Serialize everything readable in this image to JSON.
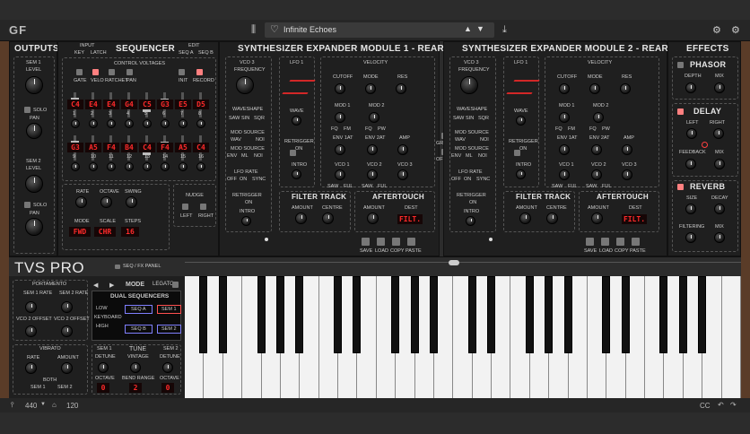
{
  "app": {
    "logo": "GF",
    "preset_name": "Infinite Echoes",
    "product": "TVS PRO",
    "seq_fx_panel": "SEQ / FX PANEL"
  },
  "outputs": {
    "title": "OUTPUTS",
    "sem1": "SEM 1",
    "sem2": "SEM 2",
    "level": "LEVEL",
    "solo": "SOLO",
    "pan": "PAN"
  },
  "sequencer": {
    "title": "SEQUENCER",
    "input": "INPUT",
    "edit": "EDIT",
    "key": "KEY",
    "latch": "LATCH",
    "seq_a": "SEQ A",
    "seq_b": "SEQ B",
    "control_voltages": "CONTROL VOLTAGES",
    "gate": "GATE",
    "velo": "VELO",
    "ratchet": "RATCHET",
    "pan": "PAN",
    "init": "INIT",
    "record": "RECORD",
    "steps_top": [
      "C4",
      "E4",
      "E4",
      "G4",
      "C5",
      "G3",
      "E5",
      "D5"
    ],
    "steps_bottom": [
      "G3",
      "A5",
      "F4",
      "B4",
      "C4",
      "F4",
      "A5",
      "C4"
    ],
    "numbers_top": [
      "1",
      "2",
      "3",
      "4",
      "5",
      "6",
      "7",
      "8"
    ],
    "numbers_bottom": [
      "9",
      "10",
      "11",
      "12",
      "13",
      "14",
      "15",
      "16"
    ],
    "rate": "RATE",
    "octave": "OCTAVE",
    "swing": "SWING",
    "mode": "MODE",
    "scale": "SCALE",
    "steps": "STEPS",
    "mode_val": "FWD",
    "scale_val": "CHR",
    "steps_val": "16",
    "nudge": "NUDGE",
    "left": "LEFT",
    "right": "RIGHT"
  },
  "mod1": {
    "title": "SYNTHESIZER EXPANDER MODULE 1 - REAR"
  },
  "mod2": {
    "title": "SYNTHESIZER EXPANDER MODULE 2 - REAR"
  },
  "module": {
    "vco3": "VCO 3",
    "frequency": "FREQUENCY",
    "waveshape": "WAVESHAPE",
    "saw": "SAW",
    "sin": "SIN",
    "sqr": "SQR",
    "mod_source": "MOD SOURCE",
    "wav": "WAV",
    "noi": "NOI",
    "env": "ENV",
    "ml": "ML",
    "lfo_rate": "LFO RATE",
    "off": "OFF",
    "on": "ON",
    "sync": "SYNC",
    "retrigger": "RETRIGGER",
    "intro": "INTRO",
    "lfo1": "LFO 1",
    "wave": "WAVE",
    "velocity": "VELOCITY",
    "cutoff": "CUTOFF",
    "mode": "MODE",
    "res": "RES",
    "mod1": "MOD 1",
    "mod2": "MOD 2",
    "fq": "FQ",
    "fm": "FM",
    "pw": "PW",
    "ful": "FUL",
    "env1at": "ENV 1AT",
    "env2at": "ENV 2AT",
    "amp": "AMP",
    "vco1": "VCO 1",
    "vco2": "VCO 2",
    "filter_track": "FILTER TRACK",
    "amount": "AMOUNT",
    "centre": "CENTRE",
    "aftertouch": "AFTERTOUCH",
    "dest": "DEST",
    "dest_val": "FILT.",
    "save": "SAVE",
    "load": "LOAD",
    "copy": "COPY",
    "paste": "PASTE",
    "group": "GROUP",
    "offset": "OFFSET"
  },
  "effects": {
    "title": "EFFECTS",
    "phasor": "PHASOR",
    "depth": "DEPTH",
    "mix": "MIX",
    "delay": "DELAY",
    "left": "LEFT",
    "right": "RIGHT",
    "feedback": "FEEDBACK",
    "reverb": "REVERB",
    "size": "SIZE",
    "decay": "DECAY",
    "filtering": "FILTERING"
  },
  "lower": {
    "portamento": "PORTAMENTO",
    "sem1_rate": "SEM 1 RATE",
    "sem2_rate": "SEM 2 RATE",
    "vco2_offset1": "VCO 2 OFFSET",
    "vco2_offset2": "VCO 2 OFFSET",
    "mode": "MODE",
    "legato": "LEGATO",
    "dual_seq": "DUAL SEQUENCERS",
    "low": "LOW",
    "keyboard": "KEYBOARD",
    "high": "HIGH",
    "seqa": "SEQ A",
    "seqb": "SEQ B",
    "sem1": "SEM 1",
    "sem2": "SEM 2",
    "vibrato": "VIBRATO",
    "rate": "RATE",
    "amount": "AMOUNT",
    "both": "BOTH",
    "tune": "TUNE",
    "detune": "DETUNE",
    "vintage": "VINTAGE",
    "octave": "OCTAVE",
    "bend_range": "BEND RANGE",
    "oct1": "0",
    "bend": "2",
    "oct2": "0"
  },
  "status": {
    "tuning": "440",
    "tempo": "120",
    "cc": "CC"
  }
}
